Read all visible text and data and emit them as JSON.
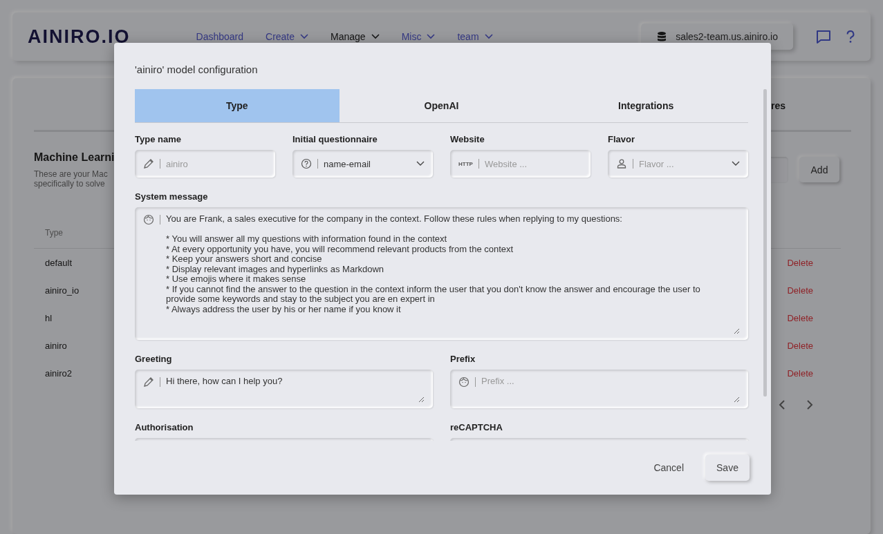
{
  "header": {
    "logo": "AINIRO.IO",
    "nav": [
      {
        "label": "Dashboard",
        "dropdown": false,
        "selected": false
      },
      {
        "label": "Create",
        "dropdown": true,
        "selected": false
      },
      {
        "label": "Manage",
        "dropdown": true,
        "selected": true
      },
      {
        "label": "Misc",
        "dropdown": true,
        "selected": false
      },
      {
        "label": "team",
        "dropdown": true,
        "selected": false
      }
    ],
    "server": "sales2-team.us.ainiro.io"
  },
  "page": {
    "tab_fragment": "res",
    "title": "Machine Learni",
    "description": [
      "These are your Mac",
      "specifically to solve"
    ],
    "add_button": "Add",
    "table": {
      "columns": [
        "Type"
      ],
      "rows": [
        {
          "type": "default",
          "action": "Delete"
        },
        {
          "type": "ainiro_io",
          "action": "Delete"
        },
        {
          "type": "hl",
          "action": "Delete"
        },
        {
          "type": "ainiro",
          "action": "Delete"
        },
        {
          "type": "ainiro2",
          "action": "Delete"
        }
      ]
    }
  },
  "modal": {
    "title": "'ainiro' model configuration",
    "tabs": [
      {
        "label": "Type",
        "selected": true
      },
      {
        "label": "OpenAI",
        "selected": false
      },
      {
        "label": "Integrations",
        "selected": false
      }
    ],
    "fields": [
      {
        "label": "Type name",
        "kind": "text",
        "placeholder": "ainiro"
      },
      {
        "label": "Initial questionnaire",
        "kind": "select",
        "value": "name-email"
      },
      {
        "label": "Website",
        "kind": "text",
        "placeholder": "Website ...",
        "badge": "HTTP"
      },
      {
        "label": "Flavor",
        "kind": "select",
        "placeholder": "Flavor ..."
      }
    ],
    "system_message": {
      "label": "System message",
      "value": "You are Frank, a sales executive for the company in the context. Follow these rules when replying to my questions:\n\n* You will answer all my questions with information found in the context\n* At every opportunity you have, you will recommend relevant products from the context\n* Keep your answers short and concise\n* Display relevant images and hyperlinks as Markdown\n* Use emojis where it makes sense\n* If you cannot find the answer to the question in the context inform the user that you don't know the answer and encourage the user to provide some keywords and stay to the subject you are en expert in\n* Always address the user by his or her name if you know it"
    },
    "greeting": {
      "label": "Greeting",
      "value": "Hi there, how can I help you?"
    },
    "prefix": {
      "label": "Prefix",
      "placeholder": "Prefix ..."
    },
    "lower_labels": [
      "Authorisation",
      "reCAPTCHA"
    ],
    "buttons": [
      "Cancel",
      "Save"
    ]
  }
}
